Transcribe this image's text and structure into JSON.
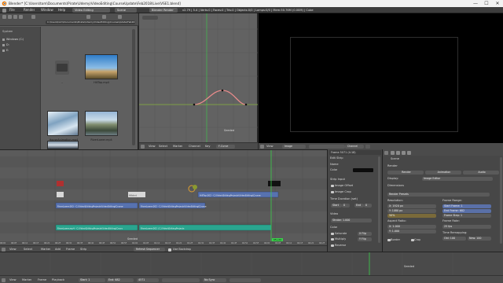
{
  "window": {
    "title": "Blender* [C:\\Users\\tom\\Documents\\Pirate\\Udemy\\VideoEditing\\CourseUpdate\\Feb2018\\Live\\VSE1.blend]",
    "minimize": "—",
    "maximize": "☐",
    "close": "✕"
  },
  "info_bar": {
    "menus": [
      "File",
      "Render",
      "Window",
      "Help"
    ],
    "layout": "Video Editing",
    "scene": "Scene",
    "engine": "Blender Render",
    "stats": "v2.79 | 5.4 | Verts:0 | Faces:0 | Tris:0 | Objects:0/0 | Lamps:0/0 | Mem:50.76M (0.00M) | Cube"
  },
  "file_browser": {
    "sidebar_header": "System",
    "sidebar_items": [
      "Windows (C:)",
      "D:",
      "E:"
    ],
    "path": "C:\\Users\\tom\\Documents\\Pirate\\Udemy\\VideoEditing\\CourseUpdate\\Feb2018\\Live\\",
    "filename": "HillTop.mp4",
    "files": [
      {
        "name": "..",
        "kind": "parent"
      },
      {
        "name": "HillTop.mp4",
        "kind": "sky"
      },
      {
        "name": "HouseAnimation.mp4",
        "kind": "snow"
      },
      {
        "name": "RiverLower.mp4",
        "kind": "river"
      },
      {
        "name": "",
        "kind": "dark"
      }
    ]
  },
  "graph_editor": {
    "footer_menus": [
      "View",
      "Select",
      "Marker",
      "Channel",
      "Key"
    ],
    "mode": "F-Curve",
    "label": "Seeded"
  },
  "preview": {
    "footer_menus": [
      "View"
    ],
    "display": "Image",
    "channel": "Channel"
  },
  "sequencer": {
    "strips": [
      {
        "label": "HillTop.002 - C:\\Video\\EditingProjects\\VideoEditing\\Course",
        "color": "#5772b0"
      },
      {
        "label": "RiverLower.003 - C:\\Video\\EditingProjects\\VideoEditing\\Course",
        "color": "#5772b0"
      },
      {
        "label": "RiverLower.002 - C:\\Video\\EditingProjects\\VideoEditing\\Course",
        "color": "#5772b0"
      },
      {
        "label": "RiverLower.mp4 - C:\\Video\\EditingProjects\\VideoEditing\\Cours",
        "color": "#2aa58f"
      },
      {
        "label": "RiverLower.002 | C:\\Video\\EditingProjects",
        "color": "#2aa58f"
      }
    ],
    "small_strips": [
      "Color 003",
      "Color",
      "Hillshot"
    ],
    "frame_badge": "05+24",
    "footer_menus": [
      "View",
      "Select",
      "Marker",
      "Add",
      "Frame",
      "Strip"
    ],
    "refresh_label": "Refresh Sequencer",
    "use_backdrop": "Use Backdrop",
    "ruler": [
      "00:00",
      "00:05",
      "00:10",
      "00:15",
      "00:20",
      "00:25",
      "00:30",
      "00:35",
      "00:40",
      "00:45",
      "00:50",
      "00:55",
      "01:00",
      "01:05",
      "01:10",
      "01:15",
      "01:20",
      "01:25",
      "01:30",
      "01:35",
      "01:40",
      "01:45",
      "01:50",
      "01:55",
      "02:00",
      "02:05",
      "02:10",
      "02:15",
      "02:20",
      "02:25"
    ],
    "label": "Seeded"
  },
  "strip_properties": {
    "header": "Frame 5071 (4:18)",
    "edit_strip": "Edit Strip",
    "name_label": "Name",
    "color_label": "Color",
    "items": [
      "Strip Input",
      "Image Offset",
      "Image Crop",
      "Time Duration (set)"
    ],
    "start": "Start",
    "start_val": "0",
    "end": "End",
    "end_val": "0",
    "section": "Video",
    "strobe": "Strobe: 1.000",
    "color_section": "Color",
    "opts": [
      "Saturate",
      "Multiply"
    ],
    "reverse": "Reverse",
    "mirror_x": "X Flip",
    "mirror_y": "Y Flip"
  },
  "properties": {
    "scene": "Scene",
    "render_section": "Render",
    "render_buttons": [
      "Render",
      "Animation",
      "Audio"
    ],
    "display_label": "Display:",
    "display_value": "Image Editor",
    "dimensions": "Dimensions",
    "render_presets": "Render Presets",
    "resolution": "Resolution:",
    "res_x": "X: 1920 px",
    "res_y": "Y: 1080 px",
    "res_pct": "50%",
    "frame_range": "Frame Range:",
    "start_frame": "Start Frame: 1",
    "end_frame": "End Frame: 682",
    "frame_step": "Frame Step: 1",
    "aspect": "Aspect Ratio:",
    "asp_x": "X: 1.000",
    "asp_y": "Y: 1.000",
    "frame_rate": "Frame Rate:",
    "fps": "25 fps",
    "time_remap": "Time Remapping:",
    "old": "Old: 100",
    "new": "New: 100",
    "border": "Border",
    "crop": "Crop"
  },
  "timeline": {
    "footer_menus": [
      "View",
      "Marker",
      "Frame",
      "Playback"
    ],
    "start": "Start: 1",
    "end": "End: 682",
    "current": "4571",
    "keying": "No Sync",
    "label": "Seeded"
  },
  "colors": {
    "strip_blue": "#5772b0",
    "strip_teal": "#2aa58f",
    "playhead": "#3bd04b",
    "curve": "#e88b8b"
  }
}
